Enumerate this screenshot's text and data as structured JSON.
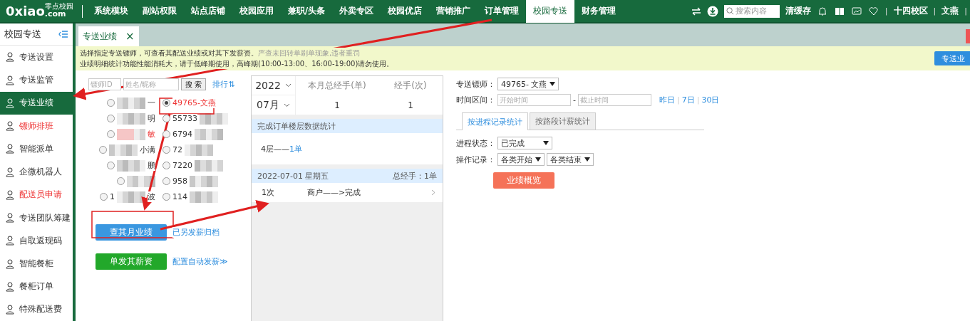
{
  "top_nav": {
    "logo": {
      "main": "0xiao",
      "sub": "零点校园",
      "domain": ".com"
    },
    "items": [
      {
        "label": "系统模块",
        "selected": false
      },
      {
        "label": "副站权限",
        "selected": false
      },
      {
        "label": "站点店铺",
        "selected": false
      },
      {
        "label": "校园应用",
        "selected": false
      },
      {
        "label": "兼职/头条",
        "selected": false
      },
      {
        "label": "外卖专区",
        "selected": false
      },
      {
        "label": "校园优店",
        "selected": false
      },
      {
        "label": "营销推广",
        "selected": false
      },
      {
        "label": "订单管理",
        "selected": false
      },
      {
        "label": "校园专送",
        "selected": true
      },
      {
        "label": "财务管理",
        "selected": false
      }
    ],
    "search": {
      "placeholder": "搜索内容"
    },
    "clear_cache": "清缓存",
    "campus": "十四校区",
    "user": "文燕",
    "separator": "|"
  },
  "sidebar": {
    "title": "校园专送",
    "items": [
      {
        "label": "专送设置",
        "selected": false,
        "alert": false
      },
      {
        "label": "专送监管",
        "selected": false,
        "alert": false
      },
      {
        "label": "专送业绩",
        "selected": true,
        "alert": false
      },
      {
        "label": "镖师排班",
        "selected": false,
        "alert": true
      },
      {
        "label": "智能派单",
        "selected": false,
        "alert": false
      },
      {
        "label": "企微机器人",
        "selected": false,
        "alert": false
      },
      {
        "label": "配送员申请",
        "selected": false,
        "alert": true
      },
      {
        "label": "专送团队筹建",
        "selected": false,
        "alert": false
      },
      {
        "label": "自取返现码",
        "selected": false,
        "alert": false
      },
      {
        "label": "智能餐柜",
        "selected": false,
        "alert": false
      },
      {
        "label": "餐柜订单",
        "selected": false,
        "alert": false
      },
      {
        "label": "特殊配送费",
        "selected": false,
        "alert": false
      }
    ]
  },
  "page_tab": {
    "label": "专送业绩",
    "close": "×"
  },
  "notice": {
    "line1": "选择指定专送镖师，可查看其配送业绩或对其下发薪资。",
    "line1_warning": "严查未回转单刷单现象,违者重罚",
    "line2": "业绩明细统计功能性能消耗大，请于低峰期使用，高峰期(10:00-13:00、16:00-19:00)请勿使用。",
    "button": "专送业"
  },
  "courier_search": {
    "id_placeholder": "镖师ID",
    "name_placeholder": "姓名/昵称",
    "button": "搜 索",
    "sort_link": "排行⇅"
  },
  "couriers": [
    {
      "after": "一",
      "blurred": true,
      "selected": false,
      "flagged": false
    },
    {
      "before": "49765-文燕",
      "selected": true,
      "flagged": true,
      "blurred": false
    },
    {
      "after": "明",
      "blurred": true,
      "selected": false,
      "flagged": false
    },
    {
      "before": "55733",
      "blurred": true,
      "selected": false,
      "flagged": false
    },
    {
      "after": "敏",
      "blurred": true,
      "selected": false,
      "flagged": true
    },
    {
      "before": "6794",
      "blurred": true,
      "selected": false,
      "flagged": false
    },
    {
      "after": "小满",
      "blurred": true,
      "selected": false,
      "flagged": false
    },
    {
      "before": "72",
      "blurred": true,
      "selected": false,
      "flagged": false
    },
    {
      "after": "鹏",
      "blurred": true,
      "selected": false,
      "flagged": false
    },
    {
      "before": "7220",
      "blurred": true,
      "selected": false,
      "flagged": false
    },
    {
      "blurred": true,
      "selected": false
    },
    {
      "before": "958",
      "blurred": true,
      "selected": false,
      "flagged": false
    },
    {
      "before": "1",
      "after": "波",
      "blurred": true,
      "selected": false,
      "flagged": false
    },
    {
      "before": "114",
      "blurred": true,
      "selected": false,
      "flagged": false
    }
  ],
  "actions": {
    "month_button": "查其月业绩",
    "archive_link": "已另发薪归档",
    "pay_button": "单发其薪资",
    "auto_pay_link": "配置自动发薪≫"
  },
  "summary": {
    "year": "2022",
    "month": "07月",
    "col_1": "本月总经手(单)",
    "col_2": "经手(次)",
    "value_1": "1",
    "value_2": "1",
    "floor_title": "完成订单楼层数据统计",
    "floor_label": "4层——",
    "floor_count": "1单",
    "day": {
      "date": "2022-07-01 星期五",
      "total": "总经手：1单",
      "rows": [
        {
          "count": "1次",
          "flow": "商户——>完成"
        }
      ]
    }
  },
  "filters": {
    "courier_label": "专送镖师：",
    "courier_value": "49765- 文燕",
    "range_label": "时间区间：",
    "start_placeholder": "开始时间",
    "dash": "-",
    "end_placeholder": "截止时间",
    "quick": [
      "昨日",
      "7日",
      "30日"
    ],
    "quick_separator": "|",
    "tabs": [
      {
        "label": "按进程记录统计",
        "selected": true
      },
      {
        "label": "按路段计薪统计",
        "selected": false
      }
    ],
    "status_label": "进程状态：",
    "status_value": "已完成",
    "record_label": "操作记录：",
    "record_start": "各类开始",
    "record_end": "各类结束",
    "button": "业绩概览"
  }
}
